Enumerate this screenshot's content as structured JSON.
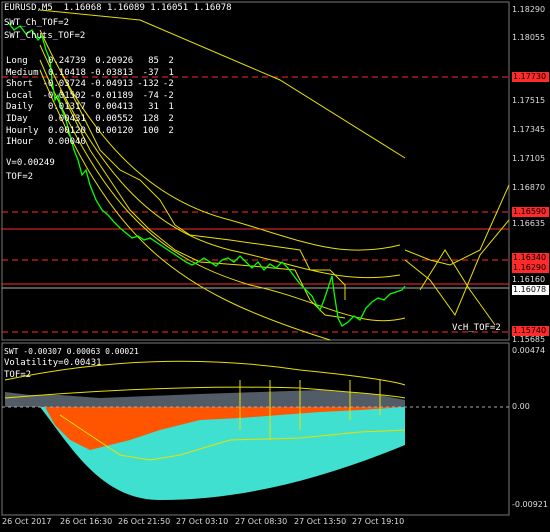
{
  "header": {
    "symbol_line": "EURUSD,M5  1.16068 1.16089 1.16051 1.16078",
    "indicator1": "SWT_Ch_TOF=2",
    "indicator2": "SWT_Chuts_TOF=2"
  },
  "stats": {
    "rows": [
      [
        "Long",
        "0.24739",
        "0.20926",
        "85",
        "2"
      ],
      [
        "Medium",
        "0.10418",
        "-0.03813",
        "-37",
        "1"
      ],
      [
        "Short",
        "-0.03724",
        "-0.04913",
        "-132",
        "-2"
      ],
      [
        "Local",
        "-0.01502",
        "-0.01189",
        "-74",
        "-2"
      ],
      [
        "Daily",
        "0.01317",
        "0.00413",
        "31",
        "1"
      ],
      [
        "IDay",
        "0.00431",
        "0.00552",
        "128",
        "2"
      ],
      [
        "Hourly",
        "0.00120",
        "0.00120",
        "100",
        "2"
      ],
      [
        "IHour",
        "0.00040",
        "",
        "",
        ""
      ]
    ],
    "v_line": "V=0.00249",
    "tof_line": "TOF=2"
  },
  "annotation_vch": "VcH_TOF=2",
  "price_axis": {
    "ticks": [
      "1.18290",
      "1.18055",
      "1.17515",
      "1.17345",
      "1.17105",
      "1.16870",
      "1.16635",
      "1.16160",
      "1.15685"
    ],
    "badges": [
      {
        "text": "1.17730",
        "color": "#ff2a2a"
      },
      {
        "text": "1.16590",
        "color": "#ff2a2a"
      },
      {
        "text": "1.16340",
        "color": "#ff2a2a"
      },
      {
        "text": "1.16290",
        "color": "#ff2a2a"
      },
      {
        "text": "1.16078",
        "color": "#ffffff"
      },
      {
        "text": "1.15740",
        "color": "#ff2a2a"
      }
    ]
  },
  "sub_window": {
    "header_line": "SWT -0.00307 0.00063 0.00021",
    "volatility": "Volatility=0.00431",
    "tof": "TOF=2",
    "axis_ticks": [
      "0.00474",
      "0.00",
      "-0.00921"
    ]
  },
  "time_axis": [
    "26 Oct 2017",
    "26 Oct 16:30",
    "26 Oct 21:50",
    "27 Oct 03:10",
    "27 Oct 08:30",
    "27 Oct 13:50",
    "27 Oct 19:10"
  ],
  "colors": {
    "background": "#000000",
    "price_line": "#00ff00",
    "channel": "#ffff00",
    "level_line": "#ff2a2a",
    "histogram_cyan": "#40e0d0",
    "histogram_orange": "#ff5500"
  }
}
